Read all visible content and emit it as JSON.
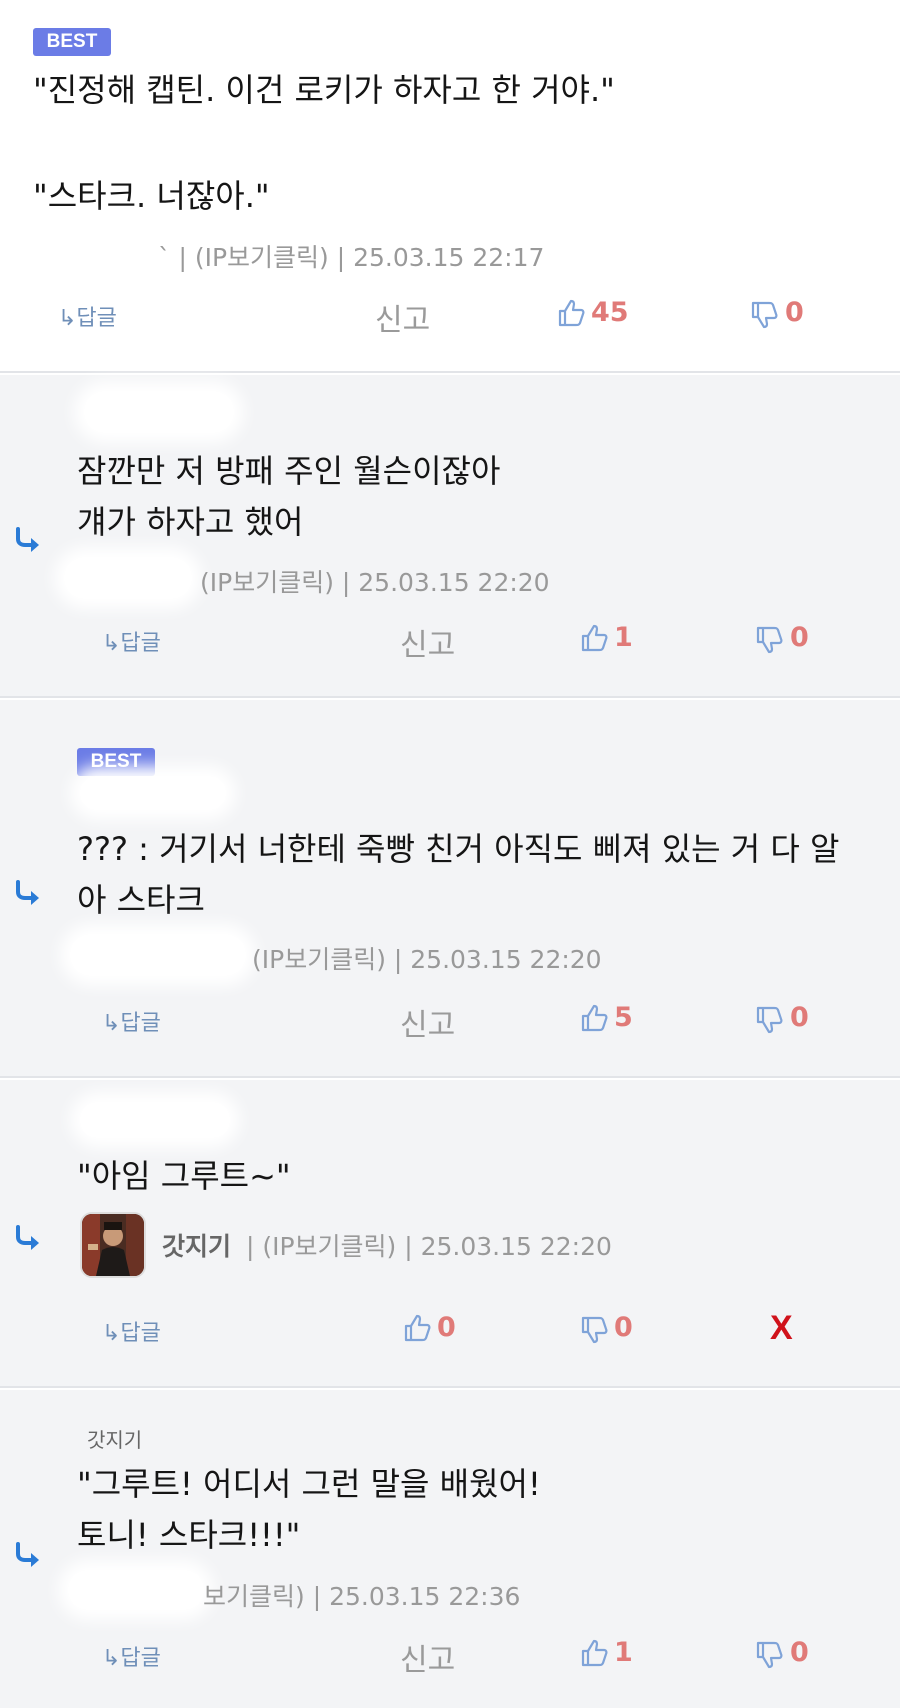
{
  "comments": [
    {
      "badge": "BEST",
      "lines": [
        "\"진정해 캡틴. 이건 로키가 하자고 한 거야.\"",
        "",
        "\"스타크. 너잖아.\""
      ],
      "meta": "` | (IP보기클릭) | 25.03.15 22:17",
      "reply_label": "↳답글",
      "report_label": "신고",
      "up": "45",
      "down": "0"
    },
    {
      "lines": [
        "잠깐만 저 방패 주인 월슨이잖아",
        "걔가 하자고 했어"
      ],
      "meta": "(IP보기클릭) | 25.03.15 22:20",
      "reply_label": "↳답글",
      "report_label": "신고",
      "up": "1",
      "down": "0"
    },
    {
      "badge": "BEST",
      "lines": [
        "??? : 거기서 너한테 죽빵 친거 아직도 삐져 있는 거 다 알",
        "아 스타크"
      ],
      "meta": "(IP보기클릭) | 25.03.15 22:20",
      "reply_label": "↳답글",
      "report_label": "신고",
      "up": "5",
      "down": "0"
    },
    {
      "lines": [
        "\"아임 그루트~\""
      ],
      "nickname": "갓지기",
      "meta": " | (IP보기클릭) | 25.03.15 22:20",
      "reply_label": "↳답글",
      "up": "0",
      "down": "0",
      "delete_label": "X"
    },
    {
      "mention": "갓지기",
      "lines": [
        "\"그루트! 어디서 그런 말을 배웠어!",
        "토니! 스타크!!!\""
      ],
      "meta": "보기클릭) | 25.03.15 22:36",
      "reply_label": "↳답글",
      "report_label": "신고",
      "up": "1",
      "down": "0"
    }
  ],
  "icons": {
    "thumb_up": "thumbs-up-icon",
    "thumb_down": "thumbs-down-icon",
    "reply_arrow": "reply-arrow-icon"
  },
  "colors": {
    "badge": "#6b7ce6",
    "count": "#e07a78",
    "reply_arrow": "#2a7bd6",
    "thumb": "#7fa3d8",
    "delete": "#d0121b"
  }
}
